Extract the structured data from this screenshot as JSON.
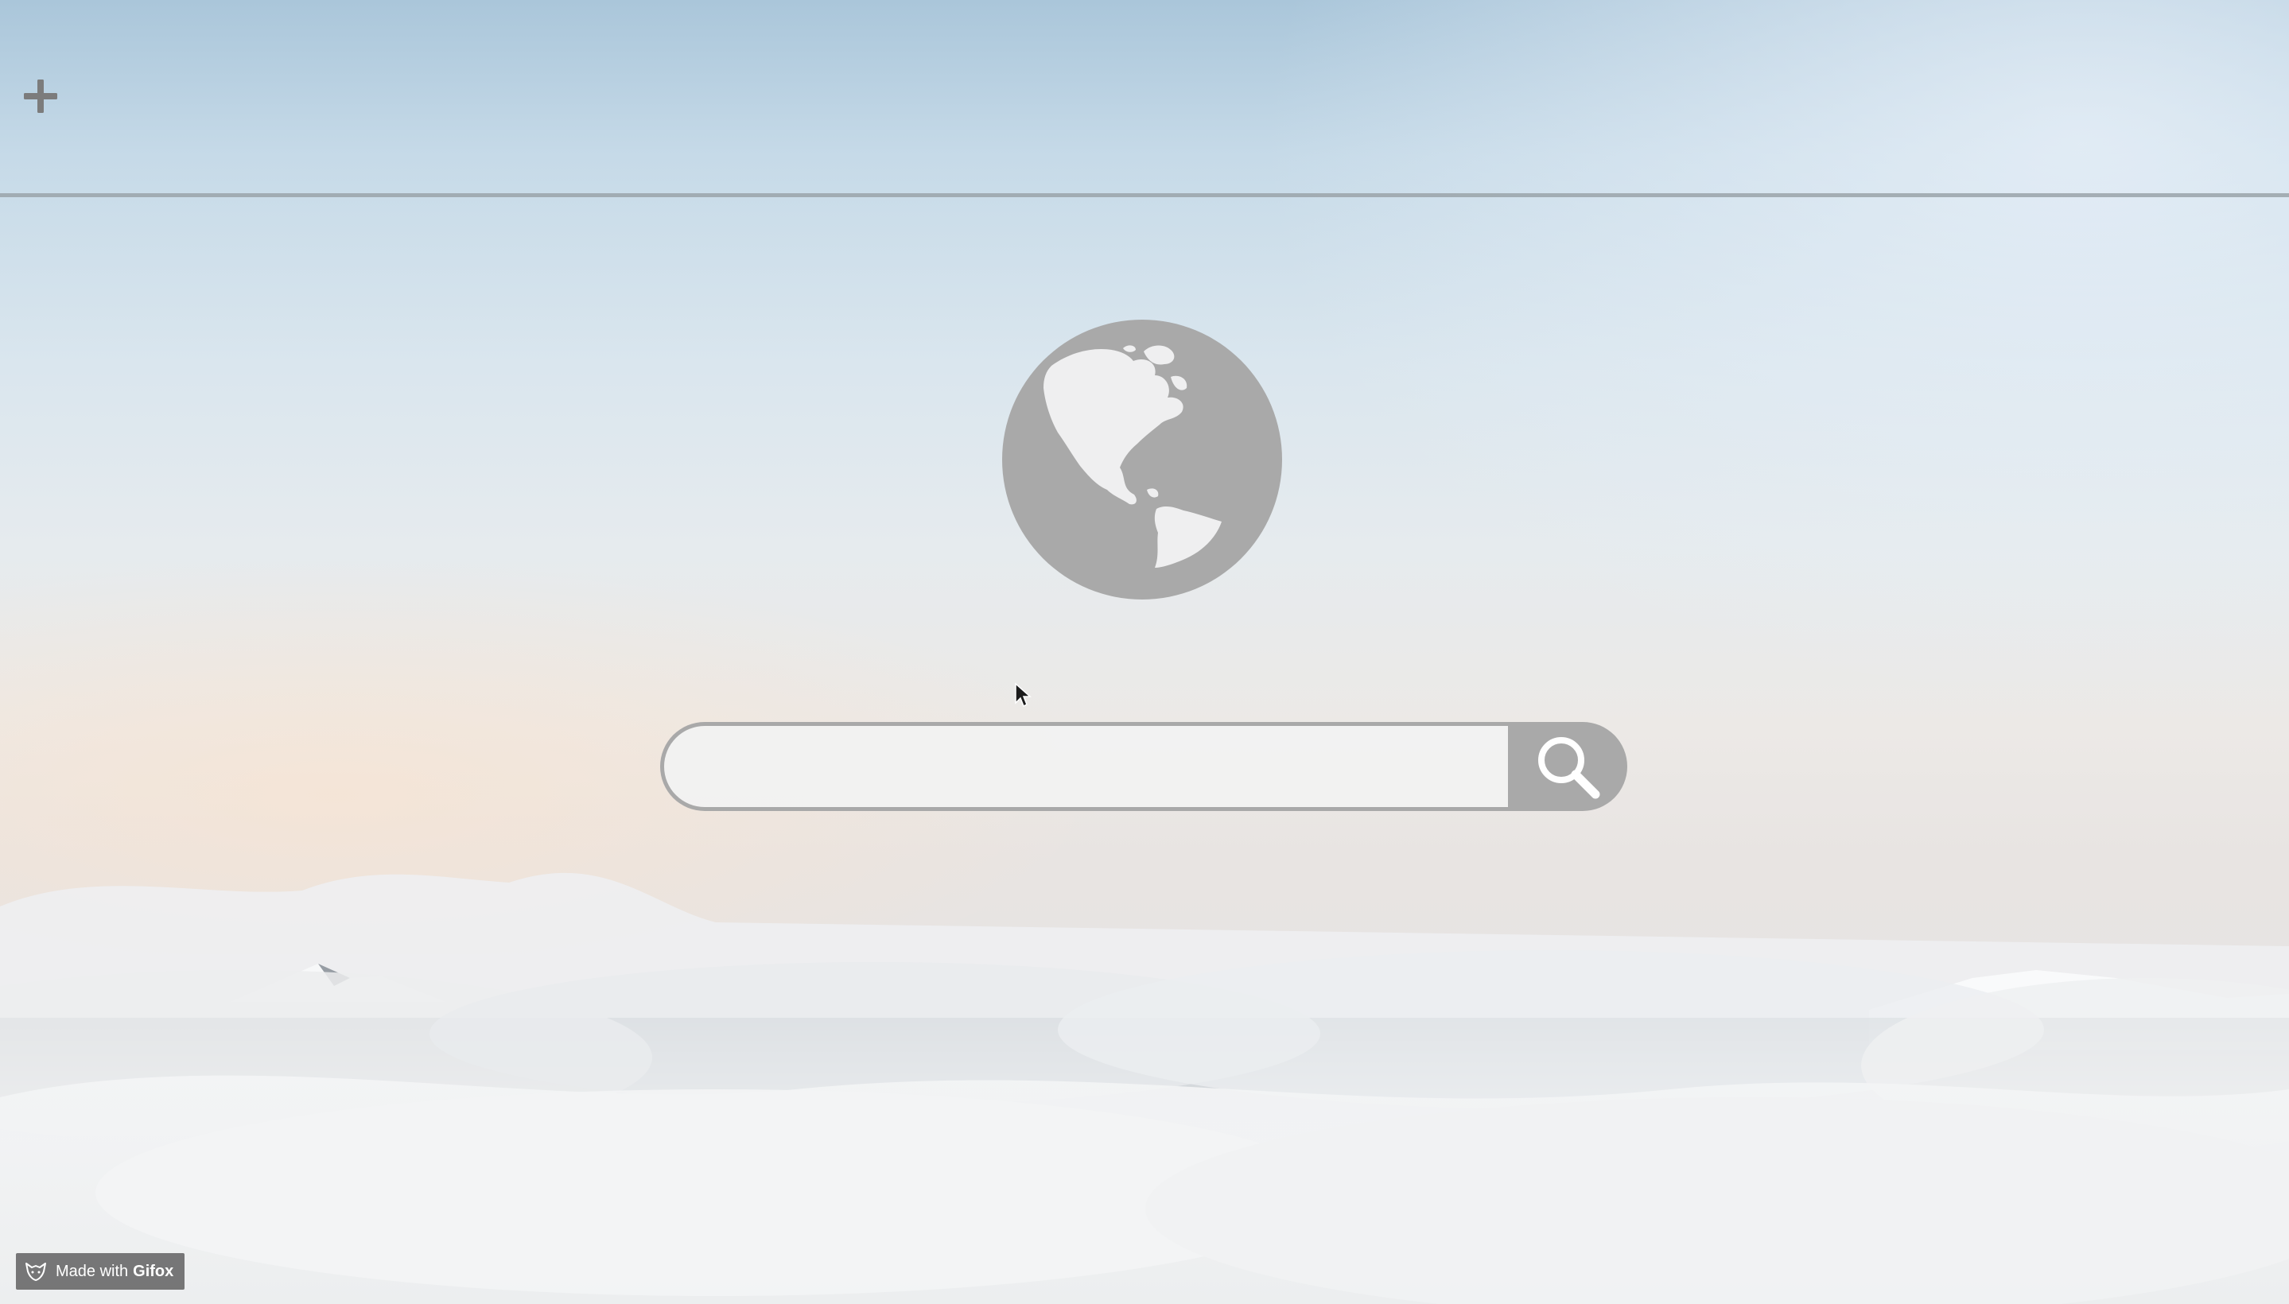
{
  "toolbar": {
    "add_icon": "plus-icon"
  },
  "logo": {
    "icon": "globe-icon",
    "color": "#a9a9a9"
  },
  "search": {
    "value": "",
    "placeholder": "",
    "button_icon": "search-icon",
    "button_color": "#a9a9a9"
  },
  "watermark": {
    "icon": "fox-icon",
    "prefix": "Made with",
    "brand": "Gifox"
  }
}
